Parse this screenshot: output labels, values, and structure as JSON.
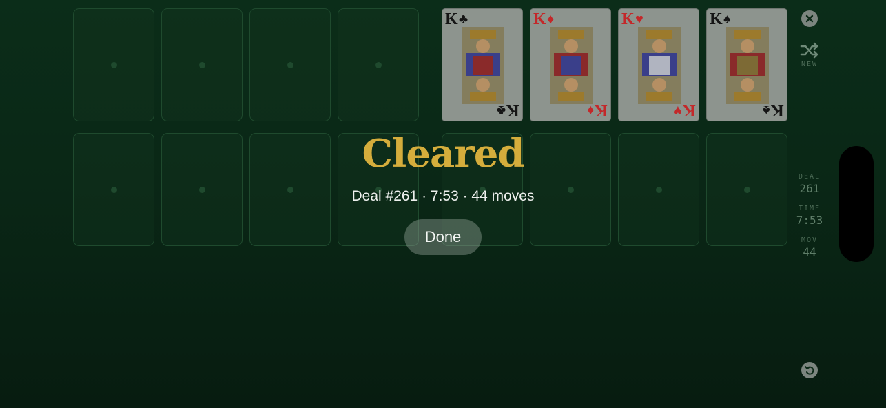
{
  "foundations": [
    {
      "rank": "K",
      "suit": "♣",
      "suit_name": "clubs",
      "color": "#151515"
    },
    {
      "rank": "K",
      "suit": "♦",
      "suit_name": "diamonds",
      "color": "#c3282a"
    },
    {
      "rank": "K",
      "suit": "♥",
      "suit_name": "hearts",
      "color": "#c3282a"
    },
    {
      "rank": "K",
      "suit": "♠",
      "suit_name": "spades",
      "color": "#151515"
    }
  ],
  "sidebar": {
    "close_icon": "close-icon",
    "new_icon": "shuffle-icon",
    "new_label": "NEW",
    "deal_label": "DEAL",
    "deal_value": "261",
    "time_label": "TIME",
    "time_value": "7:53",
    "moves_label": "MOV",
    "moves_value": "44",
    "undo_icon": "undo-icon"
  },
  "overlay": {
    "title": "Cleared",
    "summary": "Deal #261 · 7:53 · 44 moves",
    "done_label": "Done"
  },
  "colors": {
    "felt": "#0a2716",
    "title_gold": "#d5ad3c"
  }
}
